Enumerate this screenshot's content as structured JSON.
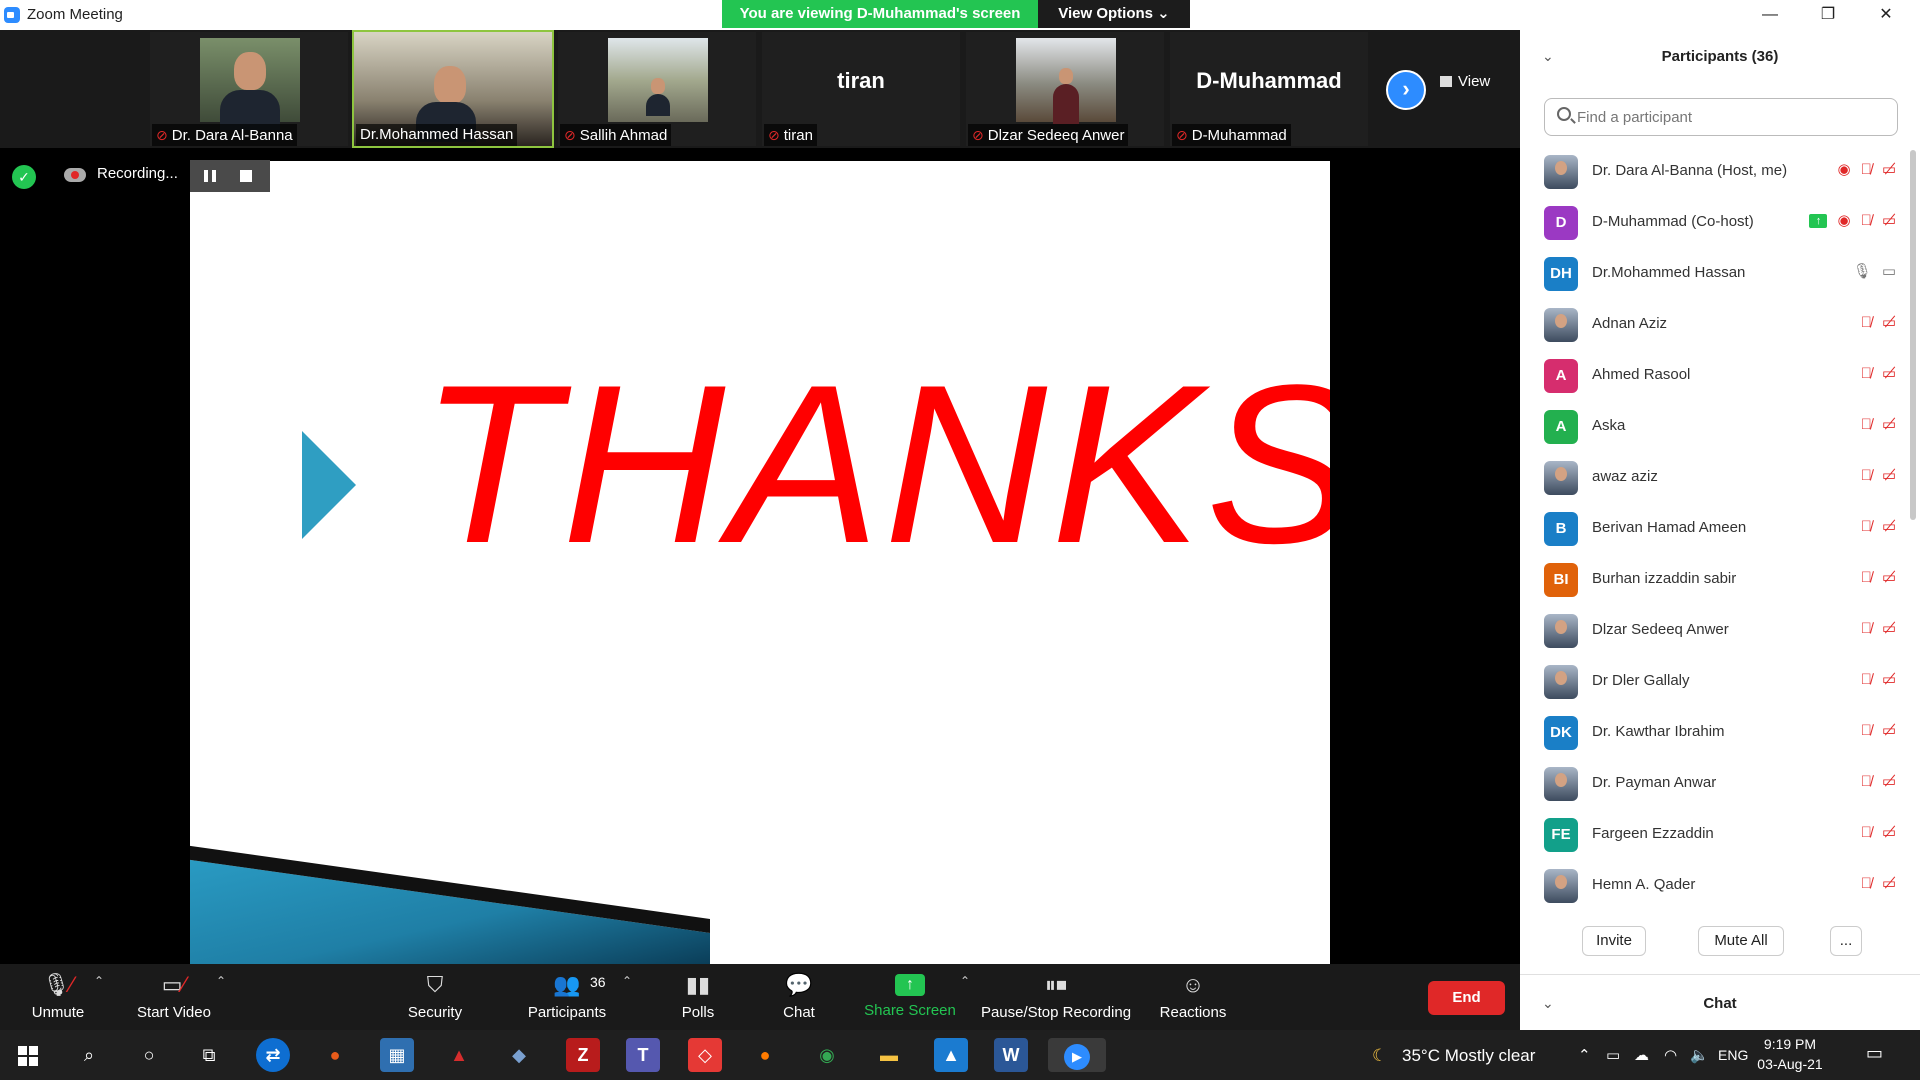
{
  "window": {
    "title": "Zoom Meeting",
    "banner": "You are viewing D-Muhammad's screen",
    "view_options": "View Options",
    "minimize": "—",
    "restore": "❐",
    "close": "✕"
  },
  "strip": {
    "thumbs": [
      {
        "label": "Dr. Dara Al-Banna",
        "muted": true
      },
      {
        "label": "Dr.Mohammed Hassan",
        "muted": false
      },
      {
        "label": "Sallih Ahmad",
        "muted": true
      },
      {
        "label": "tiran",
        "muted": true,
        "big": "tiran"
      },
      {
        "label": "Dlzar Sedeeq Anwer",
        "muted": true
      },
      {
        "label": "D-Muhammad",
        "muted": true,
        "big": "D-Muhammad"
      }
    ],
    "view_label": "View"
  },
  "recording": {
    "text": "Recording..."
  },
  "slide": {
    "text": "THANKS"
  },
  "toolbar": {
    "unmute": "Unmute",
    "start_video": "Start Video",
    "security": "Security",
    "participants": "Participants",
    "participants_count": "36",
    "polls": "Polls",
    "chat": "Chat",
    "share_screen": "Share Screen",
    "pause_stop_recording": "Pause/Stop Recording",
    "reactions": "Reactions",
    "end": "End"
  },
  "panel": {
    "title": "Participants (36)",
    "search_placeholder": "Find a participant",
    "participants": [
      {
        "name": "Dr. Dara Al-Banna (Host, me)",
        "avatar": "photo",
        "color": "",
        "rec": true,
        "share": false,
        "mic_on": false
      },
      {
        "name": "D-Muhammad (Co-host)",
        "avatar": "D",
        "color": "#9b39c3",
        "rec": true,
        "share": true,
        "mic_on": false
      },
      {
        "name": "Dr.Mohammed Hassan",
        "avatar": "DH",
        "color": "#1a7fc7",
        "rec": false,
        "share": false,
        "mic_on": true
      },
      {
        "name": "Adnan Aziz",
        "avatar": "photo",
        "color": "",
        "rec": false,
        "share": false,
        "mic_on": false
      },
      {
        "name": "Ahmed Rasool",
        "avatar": "A",
        "color": "#d62d6e",
        "rec": false,
        "share": false,
        "mic_on": false
      },
      {
        "name": "Aska",
        "avatar": "A",
        "color": "#23b04f",
        "rec": false,
        "share": false,
        "mic_on": false
      },
      {
        "name": "awaz aziz",
        "avatar": "photo",
        "color": "",
        "rec": false,
        "share": false,
        "mic_on": false
      },
      {
        "name": "Berivan Hamad Ameen",
        "avatar": "B",
        "color": "#1a7fc7",
        "rec": false,
        "share": false,
        "mic_on": false
      },
      {
        "name": "Burhan izzaddin sabir",
        "avatar": "BI",
        "color": "#e0620a",
        "rec": false,
        "share": false,
        "mic_on": false
      },
      {
        "name": "Dlzar Sedeeq Anwer",
        "avatar": "photo",
        "color": "",
        "rec": false,
        "share": false,
        "mic_on": false
      },
      {
        "name": "Dr Dler Gallaly",
        "avatar": "photo",
        "color": "",
        "rec": false,
        "share": false,
        "mic_on": false
      },
      {
        "name": "Dr. Kawthar Ibrahim",
        "avatar": "DK",
        "color": "#1a7fc7",
        "rec": false,
        "share": false,
        "mic_on": false
      },
      {
        "name": "Dr. Payman Anwar",
        "avatar": "photo",
        "color": "",
        "rec": false,
        "share": false,
        "mic_on": false
      },
      {
        "name": "Fargeen Ezzaddin",
        "avatar": "FE",
        "color": "#12a08a",
        "rec": false,
        "share": false,
        "mic_on": false
      },
      {
        "name": "Hemn A. Qader",
        "avatar": "photo",
        "color": "",
        "rec": false,
        "share": false,
        "mic_on": false
      }
    ],
    "invite": "Invite",
    "mute_all": "Mute All",
    "more": "...",
    "chat_title": "Chat"
  },
  "taskbar": {
    "weather": "35°C  Mostly clear",
    "language": "ENG",
    "time": "9:19 PM",
    "date": "03-Aug-21"
  }
}
